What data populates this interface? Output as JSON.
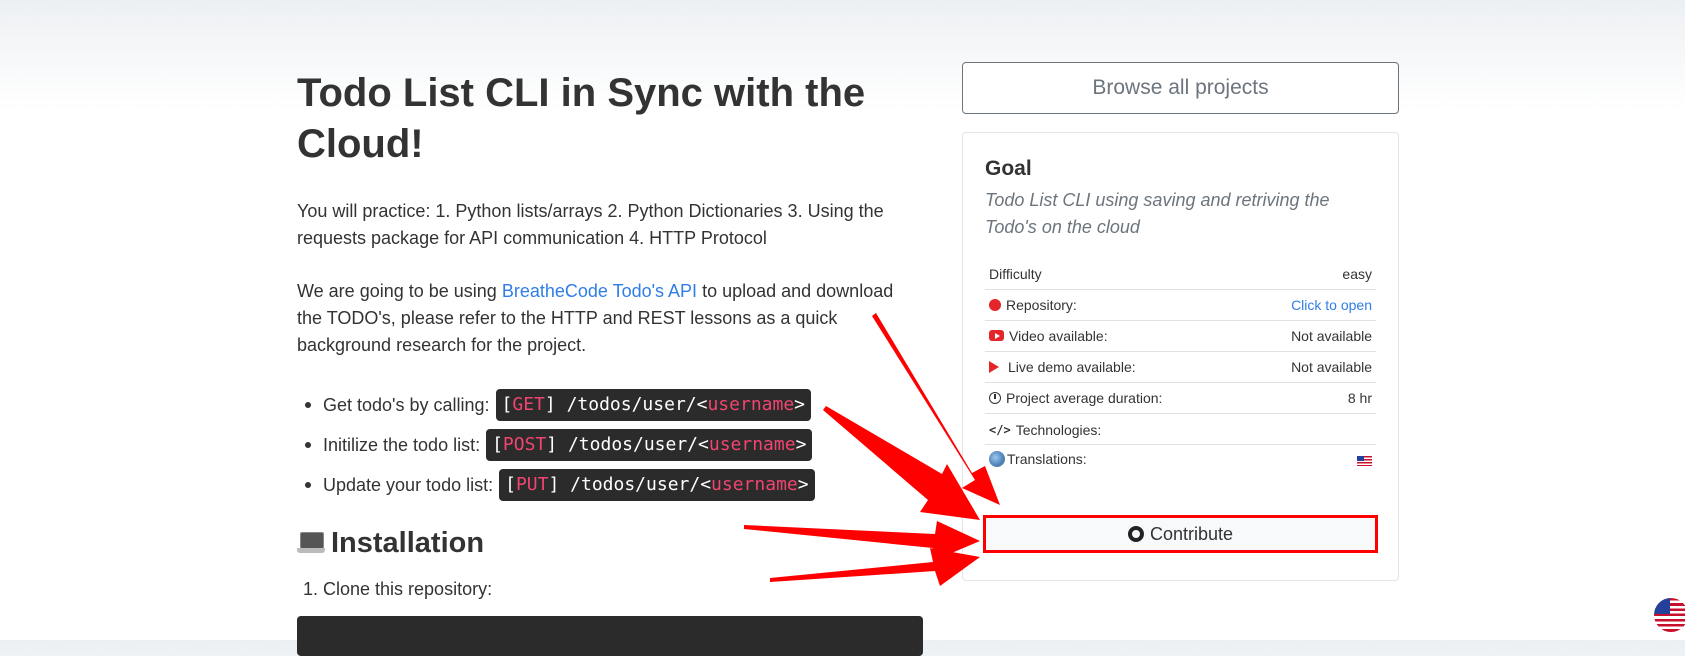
{
  "main": {
    "title": "Todo List CLI in Sync with the Cloud!",
    "practice": "You will practice: 1. Python lists/arrays 2. Python Dictionaries 3. Using the requests package for API communication 4. HTTP Protocol",
    "intro_before": "We are going to be using ",
    "intro_link": "BreatheCode Todo's API",
    "intro_after": " to upload and download the TODO's, please refer to the HTTP and REST lessons as a quick background research for the project.",
    "endpoints": [
      {
        "label": "Get todo's by calling:",
        "method": "GET",
        "path": "/todos/user/<",
        "param": "username",
        "close": ">"
      },
      {
        "label": "Initilize the todo list:",
        "method": "POST",
        "path": "/todos/user/<",
        "param": "username",
        "close": ">"
      },
      {
        "label": "Update your todo list:",
        "method": "PUT",
        "path": "/todos/user/<",
        "param": "username",
        "close": ">"
      }
    ],
    "installation_heading": "Installation",
    "steps": [
      "Clone this repository:"
    ]
  },
  "sidebar": {
    "browse_label": "Browse all projects",
    "goal_title": "Goal",
    "goal_text": "Todo List CLI using saving and retriving the Todo's on the cloud",
    "info": {
      "difficulty_label": "Difficulty",
      "difficulty_value": "easy",
      "repository_label": "Repository:",
      "repository_value": "Click to open",
      "video_label": "Video available:",
      "video_value": "Not available",
      "demo_label": "Live demo available:",
      "demo_value": "Not available",
      "duration_label": "Project average duration:",
      "duration_value": "8 hr",
      "technologies_label": "Technologies:",
      "translations_label": "Translations:"
    },
    "contribute_label": "Contribute"
  },
  "colors": {
    "link": "#2f7ee6",
    "code_bg": "#2b2b2b",
    "code_keyword": "#f2446e",
    "annotation_red": "#ff0000"
  },
  "icons": [
    "laptop-icon",
    "github-icon",
    "youtube-icon",
    "play-icon",
    "clock-icon",
    "code-icon",
    "globe-icon",
    "us-flag-icon"
  ]
}
